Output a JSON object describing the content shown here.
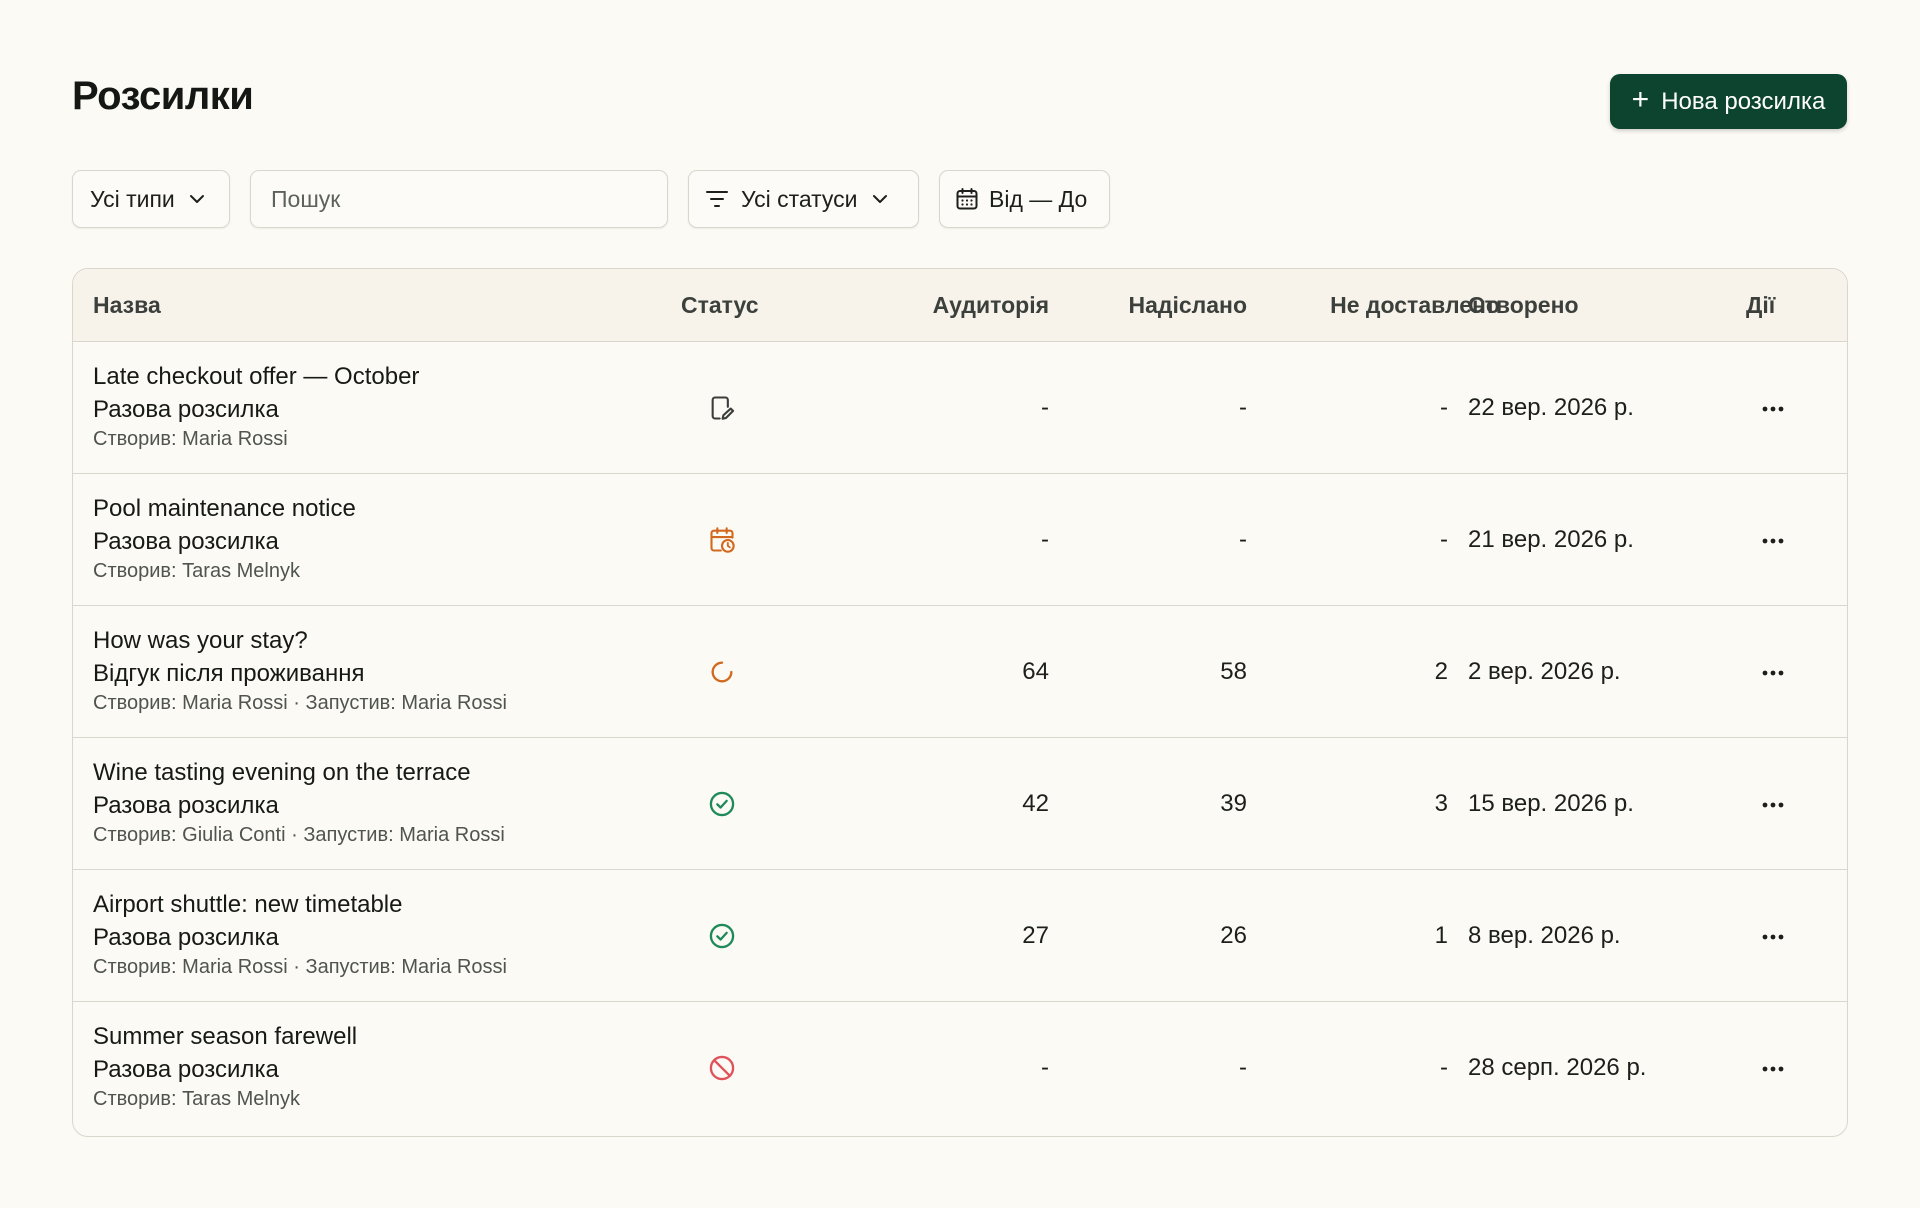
{
  "header": {
    "title": "Розсилки",
    "new_button": "Нова розсилка"
  },
  "filters": {
    "types": "Усі типи",
    "search_placeholder": "Пошук",
    "statuses": "Усі статуси",
    "date_range": "Від — До"
  },
  "table": {
    "columns": [
      "Назва",
      "Статус",
      "Аудиторія",
      "Надіслано",
      "Не доставлено",
      "Створено",
      "Дії"
    ],
    "rows": [
      {
        "title": "Late checkout offer — October",
        "type": "Разова розсилка",
        "meta": "Створив: Maria Rossi",
        "status": "draft",
        "audience": "-",
        "sent": "-",
        "failed": "-",
        "created": "22 вер. 2026 р."
      },
      {
        "title": "Pool maintenance notice",
        "type": "Разова розсилка",
        "meta": "Створив: Taras Melnyk",
        "status": "scheduled",
        "audience": "-",
        "sent": "-",
        "failed": "-",
        "created": "21 вер. 2026 р."
      },
      {
        "title": "How was your stay?",
        "type": "Відгук після проживання",
        "meta": "Створив: Maria Rossi · Запустив: Maria Rossi",
        "status": "in-progress",
        "audience": "64",
        "sent": "58",
        "failed": "2",
        "created": "2 вер. 2026 р."
      },
      {
        "title": "Wine tasting evening on the terrace",
        "type": "Разова розсилка",
        "meta": "Створив: Giulia Conti · Запустив: Maria Rossi",
        "status": "completed",
        "audience": "42",
        "sent": "39",
        "failed": "3",
        "created": "15 вер. 2026 р."
      },
      {
        "title": "Airport shuttle: new timetable",
        "type": "Разова розсилка",
        "meta": "Створив: Maria Rossi · Запустив: Maria Rossi",
        "status": "completed",
        "audience": "27",
        "sent": "26",
        "failed": "1",
        "created": "8 вер. 2026 р."
      },
      {
        "title": "Summer season farewell",
        "type": "Разова розсилка",
        "meta": "Створив: Taras Melnyk",
        "status": "cancelled",
        "audience": "-",
        "sent": "-",
        "failed": "-",
        "created": "28 серп. 2026 р."
      }
    ]
  },
  "status_icons": {
    "draft": {
      "icon": "draft-edit-icon",
      "color": "#3a3d3a"
    },
    "scheduled": {
      "icon": "calendar-clock-icon",
      "color": "#d2691e"
    },
    "in-progress": {
      "icon": "spinner-icon",
      "color": "#d2691e"
    },
    "completed": {
      "icon": "check-circle-icon",
      "color": "#1e8a5a"
    },
    "cancelled": {
      "icon": "ban-icon",
      "color": "#e0525a"
    }
  },
  "colors": {
    "background": "#fcfaf4",
    "accent": "#0d4430",
    "border": "#d9d6cc",
    "header_bg": "#f7f3ea"
  }
}
